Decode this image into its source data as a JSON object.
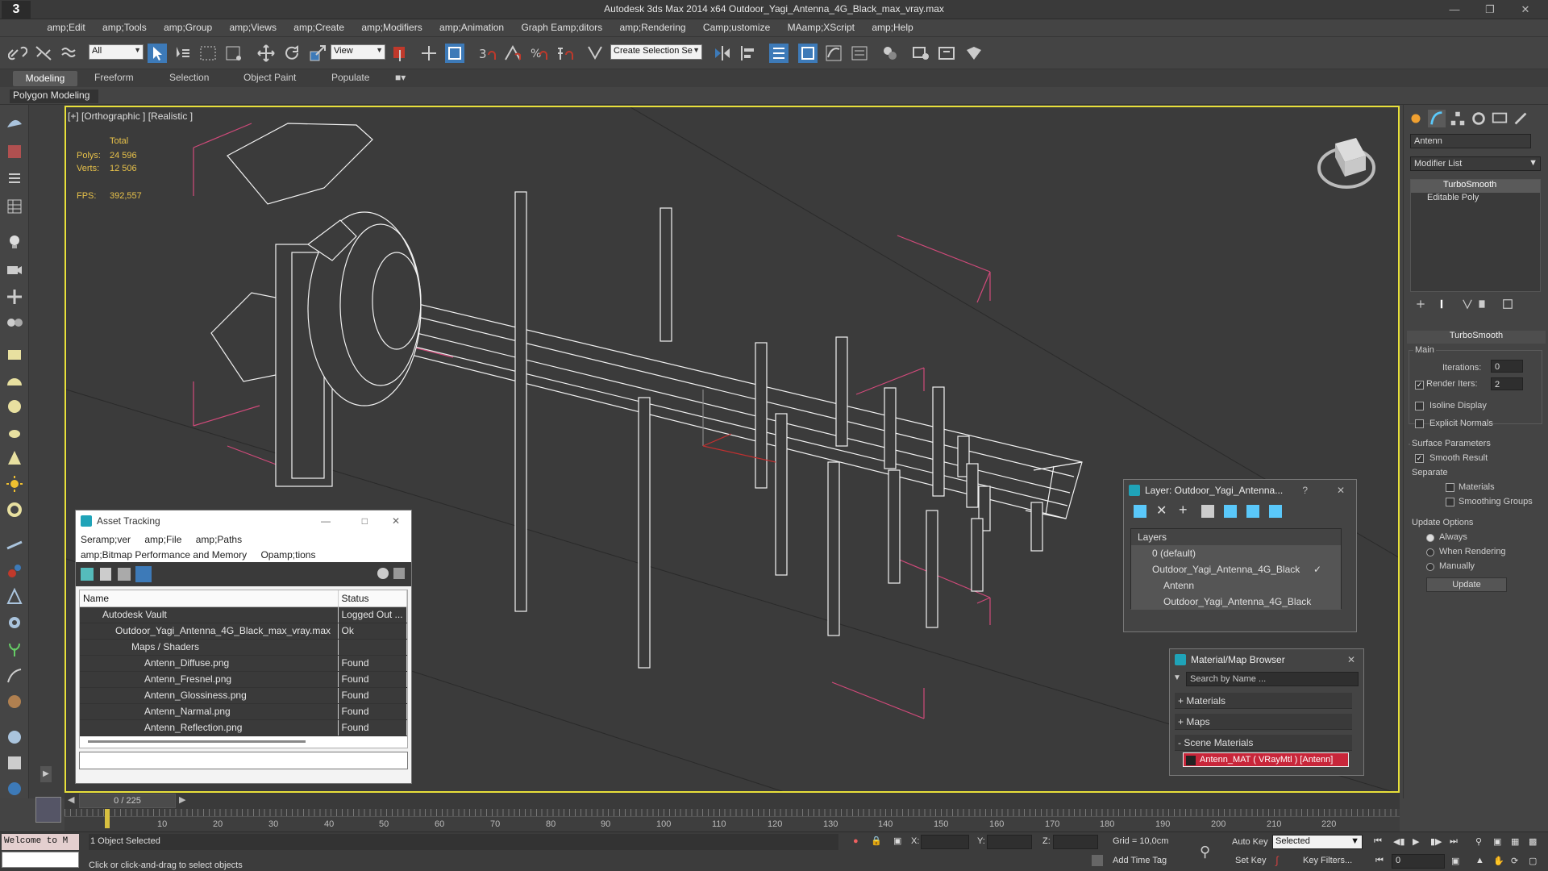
{
  "app": {
    "title": "Autodesk 3ds Max  2014 x64     Outdoor_Yagi_Antenna_4G_Black_max_vray.max",
    "logo": "3"
  },
  "menu": [
    "amp;Edit",
    "amp;Tools",
    "amp;Group",
    "amp;Views",
    "amp;Create",
    "amp;Modifiers",
    "amp;Animation",
    "Graph Eamp;ditors",
    "amp;Rendering",
    "Camp;ustomize",
    "MAamp;XScript",
    "amp;Help"
  ],
  "toolbar": {
    "selection_filter": "All",
    "ref_coord": "View",
    "named_selection": "Create Selection Se"
  },
  "ribbon": {
    "tabs": [
      "Modeling",
      "Freeform",
      "Selection",
      "Object Paint",
      "Populate"
    ],
    "sub": "Polygon Modeling"
  },
  "viewport": {
    "label": "[+] [Orthographic ] [Realistic ]",
    "stats": {
      "total_label": "Total",
      "polys_label": "Polys:",
      "polys": "24 596",
      "verts_label": "Verts:",
      "verts": "12 506",
      "fps_label": "FPS:",
      "fps": "392,557"
    }
  },
  "command_panel": {
    "object_name": "Antenn",
    "modifier_list": "Modifier List",
    "stack": [
      "TurboSmooth",
      "Editable Poly"
    ],
    "rollout": "TurboSmooth",
    "main_label": "Main",
    "iterations_label": "Iterations:",
    "iterations": "0",
    "render_iters_label": "Render Iters:",
    "render_iters": "2",
    "isoline": "Isoline Display",
    "explicit": "Explicit Normals",
    "surface_label": "Surface Parameters",
    "smooth_result": "Smooth Result",
    "separate_label": "Separate",
    "materials": "Materials",
    "smoothing_groups": "Smoothing Groups",
    "update_options": "Update Options",
    "always": "Always",
    "when_rendering": "When Rendering",
    "manually": "Manually",
    "update_button": "Update"
  },
  "asset_tracking": {
    "title": "Asset Tracking",
    "menu": [
      "Seramp;ver",
      "amp;File",
      "amp;Paths"
    ],
    "menu2": [
      "amp;Bitmap Performance and Memory",
      "Opamp;tions"
    ],
    "columns": [
      "Name",
      "Status"
    ],
    "rows": [
      {
        "name": "Autodesk Vault",
        "status": "Logged Out ..."
      },
      {
        "name": "Outdoor_Yagi_Antenna_4G_Black_max_vray.max",
        "status": "Ok"
      },
      {
        "name": "Maps / Shaders",
        "status": ""
      },
      {
        "name": "Antenn_Diffuse.png",
        "status": "Found"
      },
      {
        "name": "Antenn_Fresnel.png",
        "status": "Found"
      },
      {
        "name": "Antenn_Glossiness.png",
        "status": "Found"
      },
      {
        "name": "Antenn_Narmal.png",
        "status": "Found"
      },
      {
        "name": "Antenn_Reflection.png",
        "status": "Found"
      }
    ]
  },
  "layer_window": {
    "title": "Layer: Outdoor_Yagi_Antenna...",
    "help": "?",
    "header": "Layers",
    "rows": [
      "0 (default)",
      "Outdoor_Yagi_Antenna_4G_Black",
      "Antenn",
      "Outdoor_Yagi_Antenna_4G_Black"
    ]
  },
  "material_browser": {
    "title": "Material/Map Browser",
    "search_placeholder": "Search by Name ...",
    "sections": [
      "+ Materials",
      "+ Maps",
      "- Scene Materials"
    ],
    "scene_item": "Antenn_MAT  ( VRayMtl )  [Antenn]"
  },
  "timeline": {
    "frame": "0 / 225",
    "ticks": [
      "10",
      "20",
      "30",
      "40",
      "50",
      "60",
      "70",
      "80",
      "90",
      "100",
      "110",
      "120",
      "130",
      "140",
      "150",
      "160",
      "170",
      "180",
      "190",
      "200",
      "210",
      "220"
    ]
  },
  "status": {
    "welcome": "Welcome to M",
    "selection": "1 Object Selected",
    "prompt": "Click or click-and-drag to select objects",
    "x_label": "X:",
    "y_label": "Y:",
    "z_label": "Z:",
    "grid": "Grid = 10,0cm",
    "add_time_tag": "Add Time Tag",
    "auto_key": "Auto Key",
    "set_key": "Set Key",
    "key_mode": "Selected",
    "key_filters": "Key Filters...",
    "frame_field": "0"
  }
}
